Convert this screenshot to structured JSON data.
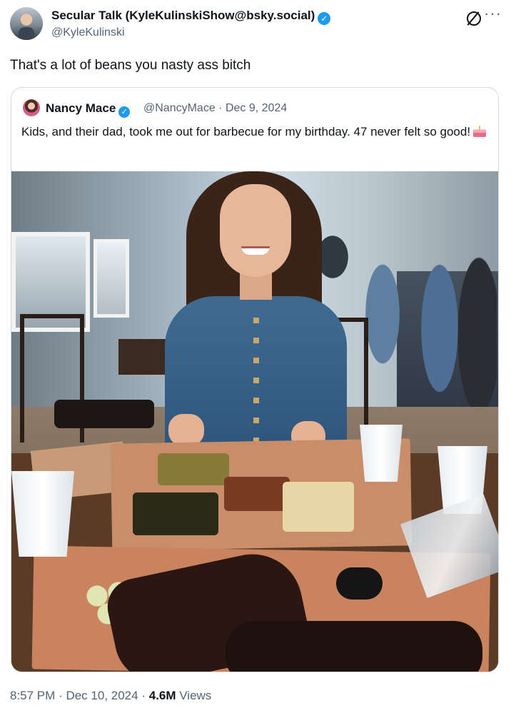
{
  "tweet": {
    "author_name": "Secular Talk (KyleKulinskiShow@bsky.social)",
    "author_handle": "@KyleKulinski",
    "text": "That's a lot of beans you nasty ass bitch",
    "time": "8:57 PM",
    "date": "Dec 10, 2024",
    "views_count": "4.6M",
    "views_label": "Views",
    "separator": "·"
  },
  "quoted_tweet": {
    "author_name": "Nancy Mace",
    "author_handle": "@NancyMace",
    "date": "Dec 9, 2024",
    "separator": "·",
    "text": "Kids, and their dad, took me out for barbecue for my birthday. 47 never felt so good!"
  },
  "icons": {
    "verified": "verified-badge-icon",
    "grok": "grok-icon",
    "more": "more-options-icon",
    "cake": "birthday-cake-emoji"
  },
  "colors": {
    "text_primary": "#0f1419",
    "text_secondary": "#536471",
    "verified_blue": "#1d9bf0",
    "border": "#cfd9de"
  }
}
